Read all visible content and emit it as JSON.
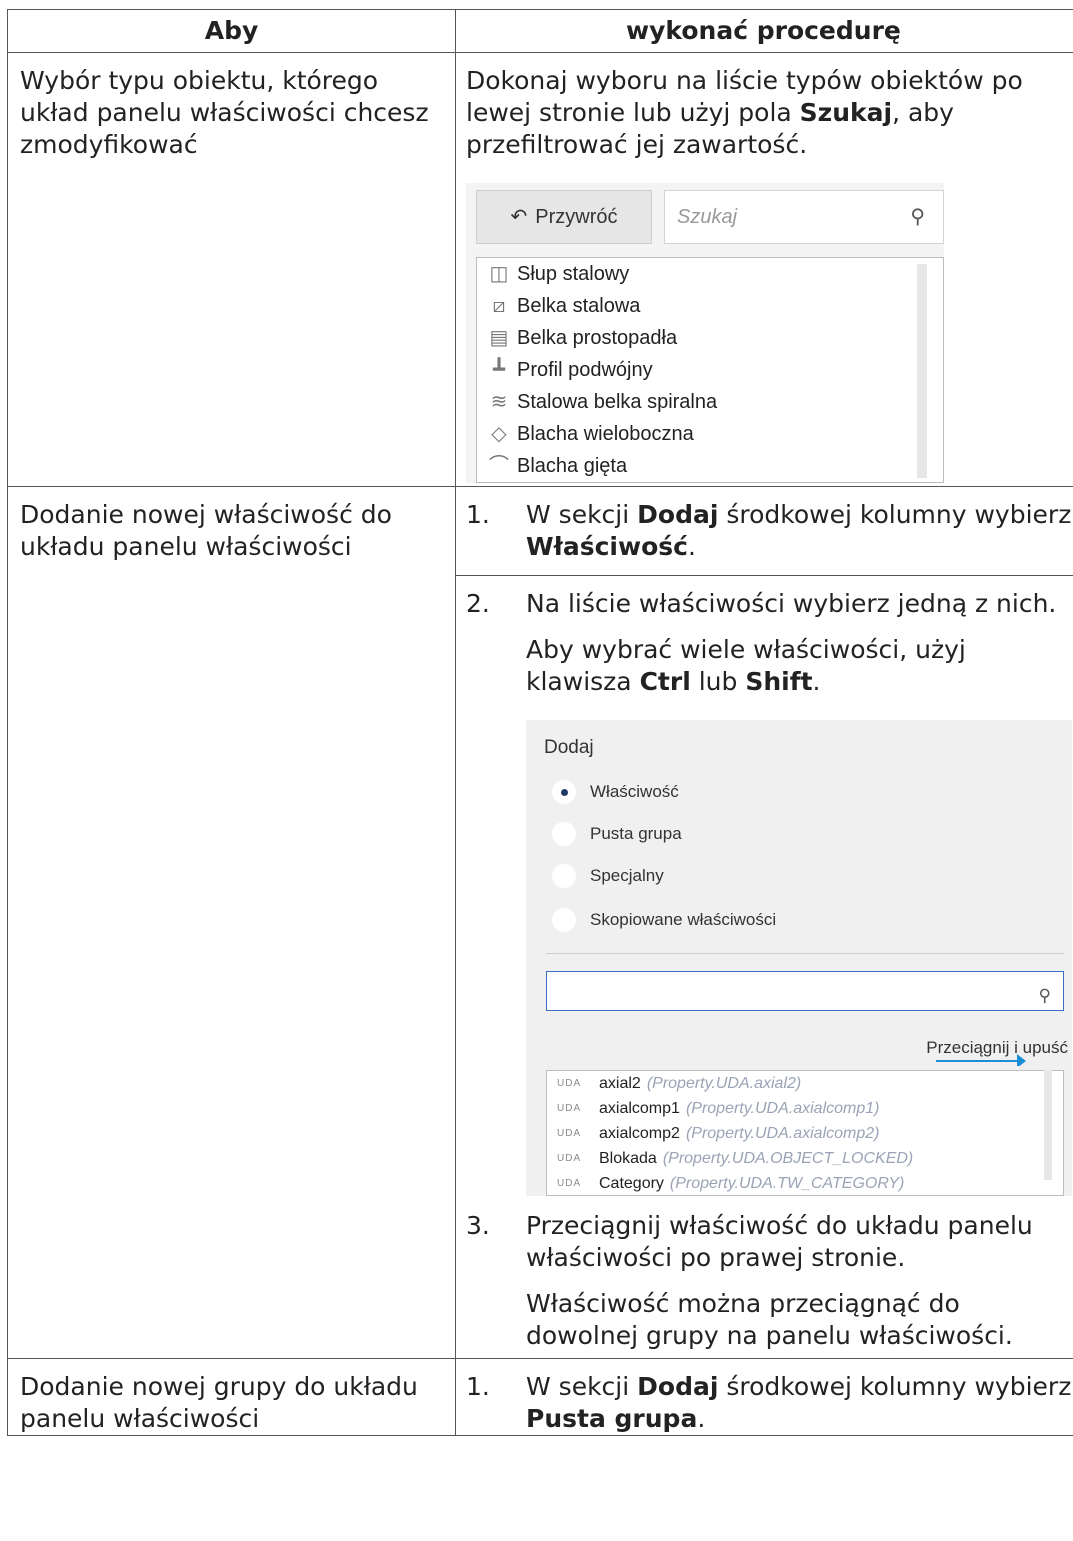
{
  "table": {
    "header": {
      "col1": "Aby",
      "col2": "wykonać procedurę"
    },
    "row1": {
      "left": "Wybór typu obiektu, którego układ panelu właściwości chcesz zmodyfikować",
      "right_a": "Dokonaj wyboru na liście typów obiektów po lewej stronie lub użyj pola ",
      "right_bold": "Szukaj",
      "right_b": ", aby przefiltrować jej zawartość."
    },
    "row2": {
      "left": "Dodanie nowej właściwość do układu panelu właściwości",
      "step1_num": "1.",
      "step1_a": "W sekcji ",
      "step1_b1": "Dodaj",
      "step1_c": " środkowej kolumny wybierz ",
      "step1_b2": "Właściwość",
      "step1_d": ".",
      "step2_num": "2.",
      "step2_text": "Na liście właściwości wybierz jedną z nich.",
      "step2_note_a": "Aby wybrać wiele właściwości, użyj klawisza ",
      "step2_note_b1": "Ctrl",
      "step2_note_c": " lub ",
      "step2_note_b2": "Shift",
      "step2_note_d": ".",
      "step3_num": "3.",
      "step3_text": "Przeciągnij właściwość do układu panelu właściwości po prawej stronie.",
      "step3_note": "Właściwość można przeciągnąć do dowolnej grupy na panelu właściwości."
    },
    "row3": {
      "left": "Dodanie nowej grupy do układu panelu właściwości",
      "step1_num": "1.",
      "step1_a": "W sekcji ",
      "step1_b1": "Dodaj",
      "step1_c": " środkowej kolumny wybierz ",
      "step1_b2": "Pusta grupa",
      "step1_d": "."
    }
  },
  "shot1": {
    "restore_label": "Przywróć",
    "restore_icon": "↶",
    "search_placeholder": "Szukaj",
    "search_icon": "⚲",
    "items": [
      {
        "icon": "◫",
        "label": "Słup stalowy"
      },
      {
        "icon": "⧄",
        "label": "Belka stalowa"
      },
      {
        "icon": "▤",
        "label": "Belka prostopadła"
      },
      {
        "icon": "┻",
        "label": "Profil podwójny"
      },
      {
        "icon": "≋",
        "label": "Stalowa belka spiralna"
      },
      {
        "icon": "◇",
        "label": "Blacha wieloboczna"
      },
      {
        "icon": "⌒",
        "label": "Blacha gięta"
      }
    ]
  },
  "shot2": {
    "header": "Dodaj",
    "options": [
      "Właściwość",
      "Pusta grupa",
      "Specjalny",
      "Skopiowane właściwości"
    ],
    "selected": "Właściwość",
    "search_icon": "⚲",
    "drag_label": "Przeciągnij i upuść",
    "accent": "#1b8ed6",
    "properties": [
      {
        "tag": "UDA",
        "name": "axial2",
        "ref": "(Property.UDA.axial2)"
      },
      {
        "tag": "UDA",
        "name": "axialcomp1",
        "ref": "(Property.UDA.axialcomp1)"
      },
      {
        "tag": "UDA",
        "name": "axialcomp2",
        "ref": "(Property.UDA.axialcomp2)"
      },
      {
        "tag": "UDA",
        "name": "Blokada",
        "ref": "(Property.UDA.OBJECT_LOCKED)"
      },
      {
        "tag": "UDA",
        "name": "Category",
        "ref": "(Property.UDA.TW_CATEGORY)"
      }
    ]
  }
}
